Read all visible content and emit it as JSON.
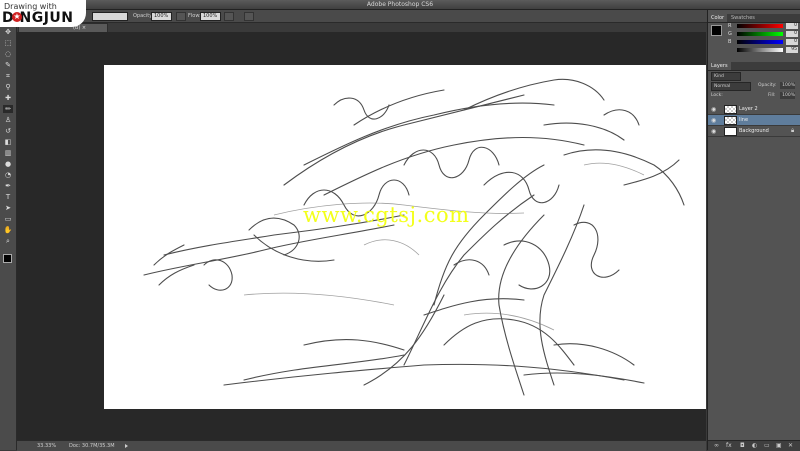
{
  "window": {
    "title": "Adobe Photoshop CS6"
  },
  "logo": {
    "line1": "Drawing with",
    "line2": "D NGJUN",
    "star_icon": "star-icon"
  },
  "options": {
    "opacity_label": "Opacity:",
    "opacity_value": "100%",
    "flow_label": "Flow:",
    "flow_value": "100%"
  },
  "document_tab": {
    "label": "(B) ×"
  },
  "canvas": {
    "watermark": "www.cgtsj.com"
  },
  "status": {
    "zoom": "33.33%",
    "doc": "Doc: 30.7M/35.3M"
  },
  "color_panel": {
    "tabs": [
      "Color",
      "Swatches"
    ],
    "channels": [
      {
        "label": "R",
        "value": "0",
        "gradient": [
          "#000000",
          "#ff0000"
        ]
      },
      {
        "label": "G",
        "value": "0",
        "gradient": [
          "#000000",
          "#00ff00"
        ]
      },
      {
        "label": "B",
        "value": "0",
        "gradient": [
          "#000000",
          "#0000ff"
        ]
      },
      {
        "label": "",
        "value": "95",
        "gradient": [
          "#000000",
          "#ffffff"
        ]
      }
    ]
  },
  "layers_panel": {
    "tabs": [
      "Layers"
    ],
    "kind": "Kind",
    "blend_mode": "Normal",
    "opacity_label": "Opacity:",
    "opacity_value": "100%",
    "lock_label": "Lock:",
    "fill_label": "Fill:",
    "fill_value": "100%",
    "layers": [
      {
        "name": "Layer 2",
        "selected": false,
        "checker": true
      },
      {
        "name": "line",
        "selected": true,
        "checker": true
      },
      {
        "name": "Background",
        "selected": false,
        "checker": false,
        "locked": true
      }
    ]
  },
  "tools": [
    "move",
    "marquee",
    "lasso",
    "quick-select",
    "crop",
    "eyedropper",
    "healing",
    "brush",
    "clone-stamp",
    "history-brush",
    "eraser",
    "gradient",
    "blur",
    "dodge",
    "pen",
    "type",
    "path-select",
    "shape",
    "hand",
    "zoom"
  ]
}
